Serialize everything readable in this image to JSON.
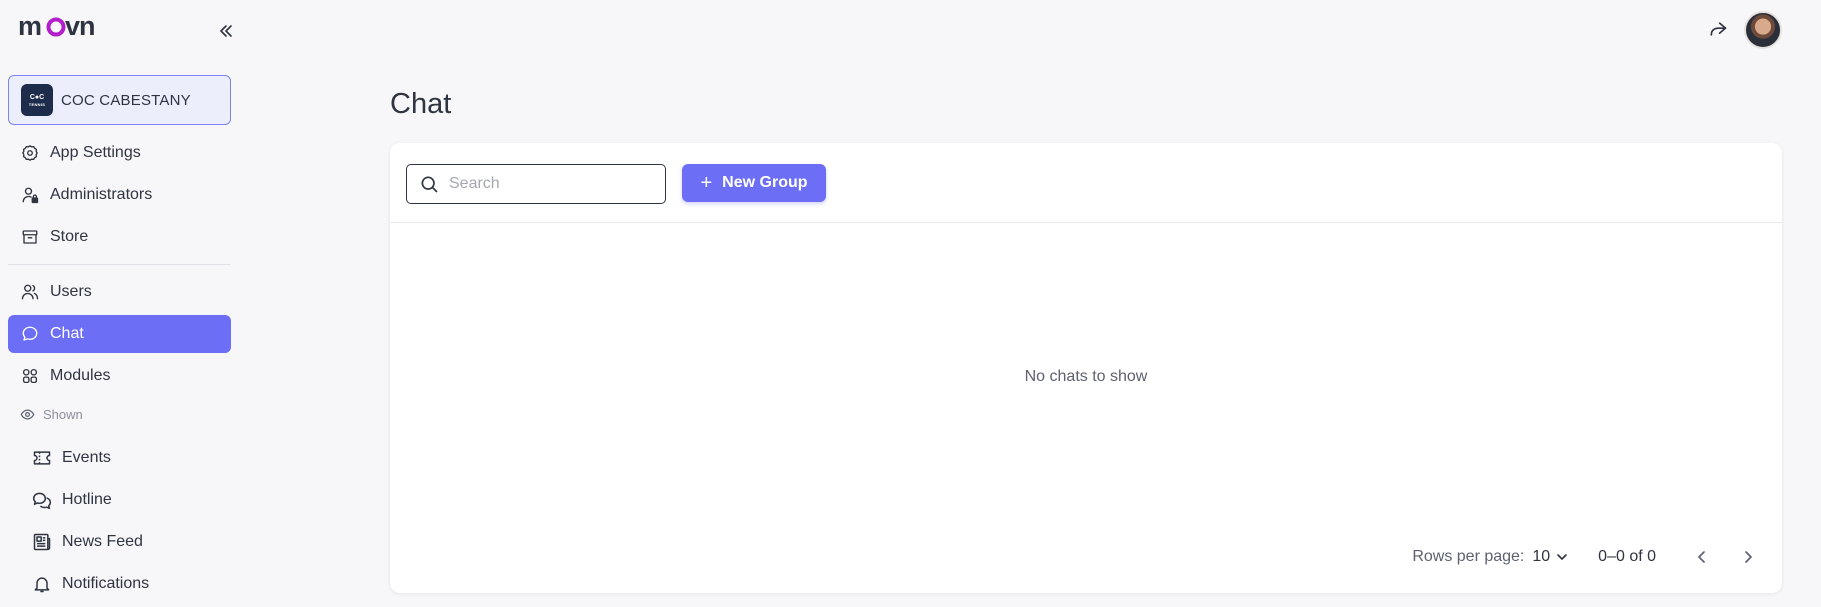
{
  "app": {
    "logo_text": "movn"
  },
  "org": {
    "name": "COC CABESTANY",
    "logo_line1": "C●C",
    "logo_line2": "TENNIS"
  },
  "sidebar": {
    "items": [
      {
        "label": "App Settings",
        "icon": "gear-icon"
      },
      {
        "label": "Administrators",
        "icon": "admin-user-icon"
      },
      {
        "label": "Store",
        "icon": "store-icon"
      },
      {
        "label": "Users",
        "icon": "users-icon"
      },
      {
        "label": "Chat",
        "icon": "chat-bubble-icon",
        "active": true
      },
      {
        "label": "Modules",
        "icon": "modules-grid-icon"
      }
    ],
    "section_label": "Shown",
    "sub_items": [
      {
        "label": "Events",
        "icon": "ticket-icon"
      },
      {
        "label": "Hotline",
        "icon": "chat-bubbles-icon"
      },
      {
        "label": "News Feed",
        "icon": "newspaper-icon"
      },
      {
        "label": "Notifications",
        "icon": "bell-icon"
      }
    ]
  },
  "main": {
    "title": "Chat",
    "search": {
      "placeholder": "Search",
      "value": ""
    },
    "new_group_label": "New Group",
    "empty_message": "No chats to show",
    "pagination": {
      "rows_per_page_label": "Rows per page:",
      "rows_per_page_value": "10",
      "range_text": "0–0 of 0"
    }
  },
  "colors": {
    "accent": "#6c6ff5",
    "logo_purple": "#b21ec9",
    "text": "#2f3441"
  }
}
